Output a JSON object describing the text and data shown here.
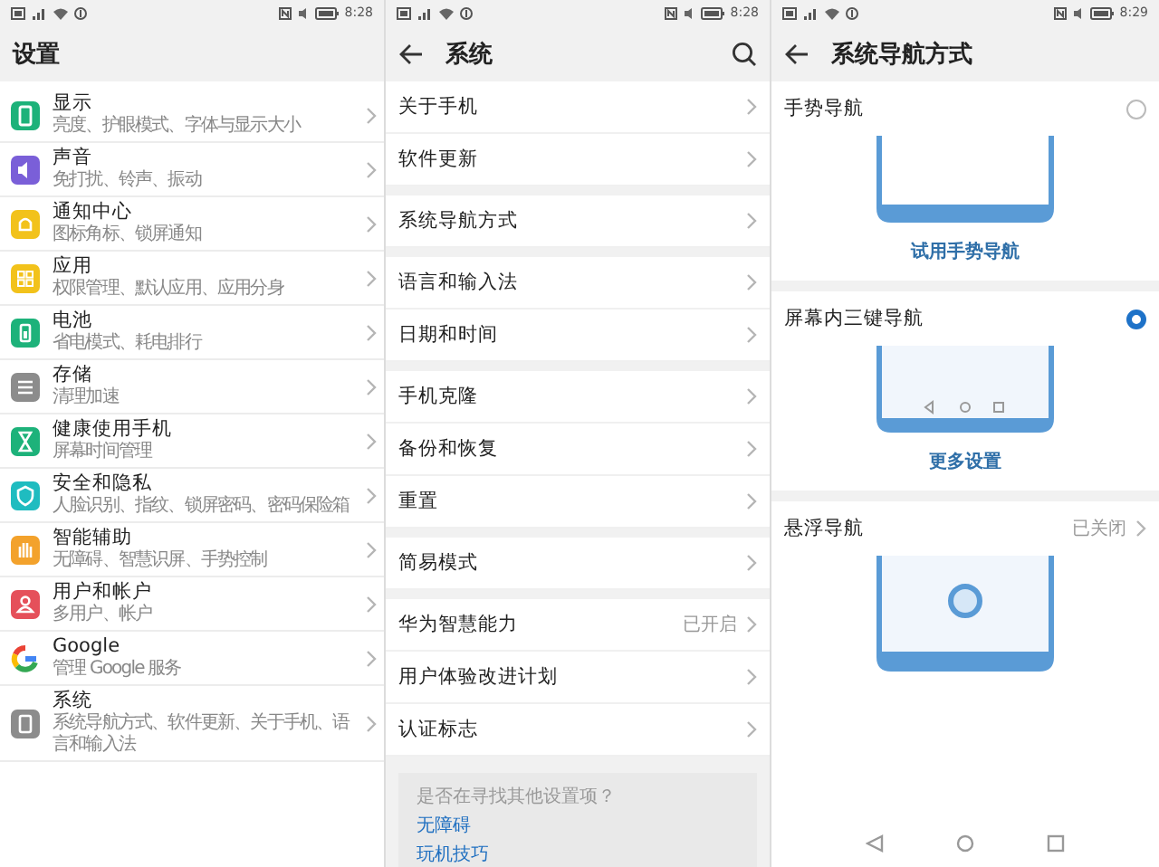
{
  "screens": [
    {
      "kind": "settings",
      "status_bar": {
        "time": "8:28"
      },
      "title": "设置",
      "items": [
        {
          "kind": "app",
          "color": "#1db27a",
          "title": "显示",
          "subtitle": "亮度、护眼模式、字体与显示大小"
        },
        {
          "kind": "app",
          "color": "#7a5fd8",
          "title": "声音",
          "subtitle": "免打扰、铃声、振动"
        },
        {
          "kind": "app",
          "color": "#f2c21b",
          "title": "通知中心",
          "subtitle": "图标角标、锁屏通知"
        },
        {
          "kind": "app",
          "color": "#f2c21b",
          "title": "应用",
          "subtitle": "权限管理、默认应用、应用分身"
        },
        {
          "kind": "app",
          "color": "#1db27a",
          "title": "电池",
          "subtitle": "省电模式、耗电排行"
        },
        {
          "kind": "app",
          "color": "#8c8c8c",
          "title": "存储",
          "subtitle": "清理加速"
        },
        {
          "kind": "app",
          "color": "#1db27a",
          "title": "健康使用手机",
          "subtitle": "屏幕时间管理"
        },
        {
          "kind": "app",
          "color": "#1fbcc0",
          "title": "安全和隐私",
          "subtitle": "人脸识别、指纹、锁屏密码、密码保险箱"
        },
        {
          "kind": "app",
          "color": "#f3a22c",
          "title": "智能辅助",
          "subtitle": "无障碍、智慧识屏、手势控制"
        },
        {
          "kind": "app",
          "color": "#e5505a",
          "title": "用户和帐户",
          "subtitle": "多用户、帐户"
        },
        {
          "kind": "google",
          "title": "Google",
          "subtitle": "管理 Google 服务"
        },
        {
          "kind": "app",
          "color": "#8c8c8c",
          "title": "系统",
          "subtitle": "系统导航方式、软件更新、关于手机、语言和输入法"
        }
      ]
    },
    {
      "kind": "system",
      "status_bar": {
        "time": "8:28"
      },
      "title": "系统",
      "groups": [
        [
          {
            "label": "关于手机"
          },
          {
            "label": "软件更新"
          }
        ],
        [
          {
            "label": "系统导航方式"
          }
        ],
        [
          {
            "label": "语言和输入法"
          },
          {
            "label": "日期和时间"
          }
        ],
        [
          {
            "label": "手机克隆"
          },
          {
            "label": "备份和恢复"
          },
          {
            "label": "重置"
          }
        ],
        [
          {
            "label": "简易模式"
          }
        ],
        [
          {
            "label": "华为智慧能力",
            "value": "已开启"
          },
          {
            "label": "用户体验改进计划"
          },
          {
            "label": "认证标志"
          }
        ]
      ],
      "suggestions": {
        "prompt": "是否在寻找其他设置项？",
        "links": [
          "无障碍",
          "玩机技巧"
        ]
      }
    },
    {
      "kind": "navigation",
      "status_bar": {
        "time": "8:29"
      },
      "title": "系统导航方式",
      "options": [
        {
          "kind": "gesture",
          "label": "手势导航",
          "selected": false,
          "action": "试用手势导航"
        },
        {
          "kind": "three_key",
          "label": "屏幕内三键导航",
          "selected": true,
          "action": "更多设置"
        }
      ],
      "floating": {
        "kind": "floating",
        "label": "悬浮导航",
        "value": "已关闭"
      }
    }
  ]
}
